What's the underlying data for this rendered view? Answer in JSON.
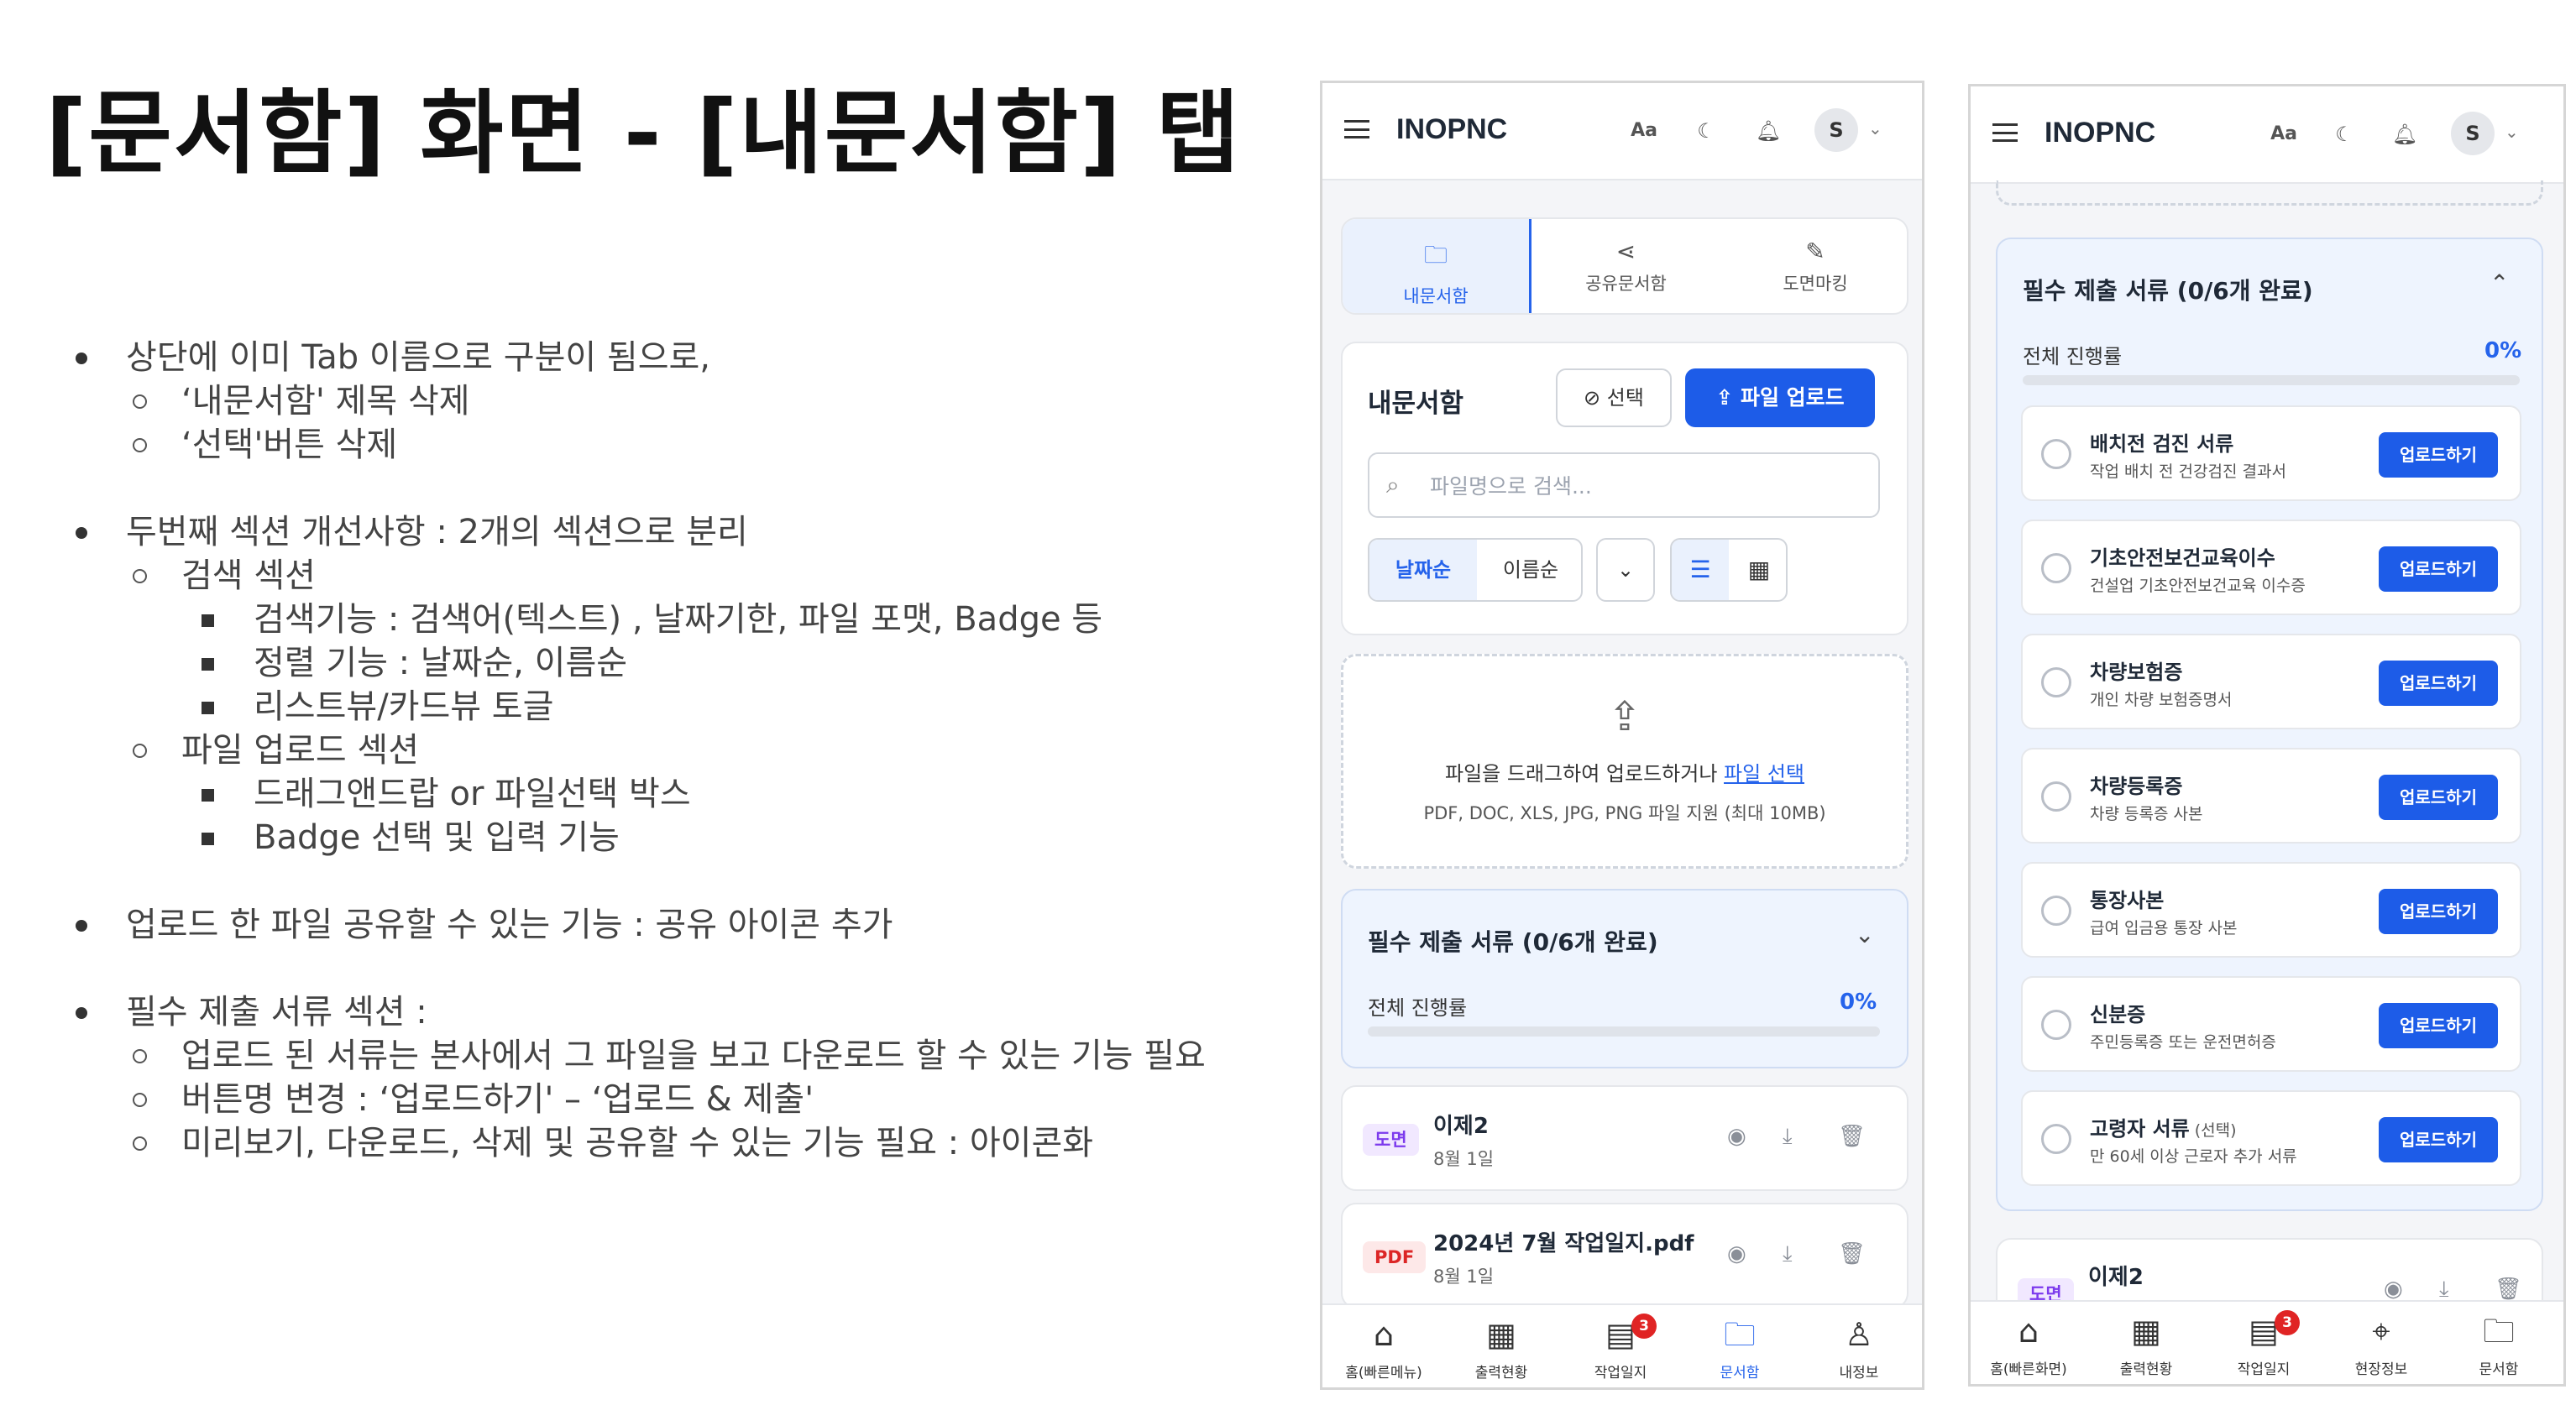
{
  "slide": {
    "title": "[문서함] 화면 - [내문서함] 탭",
    "notes": [
      {
        "level": 1,
        "text": "상단에 이미 Tab 이름으로 구분이 됨으로,"
      },
      {
        "level": 2,
        "text": "‘내문서함' 제목 삭제"
      },
      {
        "level": 2,
        "text": "‘선택'버튼 삭제"
      },
      {
        "level": 1,
        "text": "두번째 섹션 개선사항 : 2개의 섹션으로 분리",
        "gap": true
      },
      {
        "level": 2,
        "text": "검색 섹션"
      },
      {
        "level": 3,
        "text": "검색기능 : 검색어(텍스트) , 날짜기한, 파일 포맷, Badge 등"
      },
      {
        "level": 3,
        "text": "정렬 기능 : 날짜순, 이름순"
      },
      {
        "level": 3,
        "text": "리스트뷰/카드뷰 토글"
      },
      {
        "level": 2,
        "text": "파일 업로드 섹션"
      },
      {
        "level": 3,
        "text": "드래그앤드랍 or 파일선택 박스"
      },
      {
        "level": 3,
        "text": "Badge 선택 및 입력 기능"
      },
      {
        "level": 1,
        "text": "업로드 한 파일 공유할 수 있는 기능 : 공유 아이콘 추가",
        "gap": true
      },
      {
        "level": 1,
        "text": "필수 제출 서류 섹션 :",
        "gap": true
      },
      {
        "level": 2,
        "text": "업로드 된 서류는 본사에서 그 파일을 보고 다운로드 할 수 있는 기능 필요"
      },
      {
        "level": 2,
        "text": "버튼명 변경 : ‘업로드하기' – ‘업로드 & 제출'"
      },
      {
        "level": 2,
        "text": "미리보기, 다운로드, 삭제 및 공유할 수 있는 기능 필요 : 아이콘화"
      }
    ]
  },
  "app": {
    "logo": "INOPNC",
    "header_icons": {
      "font_size": "Aa",
      "avatar_letter": "S"
    },
    "tabs": [
      {
        "label": "내문서함",
        "icon": "folder-open-icon",
        "active": true
      },
      {
        "label": "공유문서함",
        "icon": "share-icon"
      },
      {
        "label": "도면마킹",
        "icon": "pencil-icon"
      }
    ],
    "doc_section": {
      "title": "내문서함",
      "select_label": "선택",
      "upload_label": "파일 업로드",
      "search_placeholder": "파일명으로 검색...",
      "sort": [
        "날짜순",
        "이름순"
      ]
    },
    "dropzone": {
      "text": "파일을 드래그하여 업로드하거나 ",
      "link": "파일 선택",
      "hint": "PDF, DOC, XLS, JPG, PNG 파일 지원 (최대 10MB)"
    },
    "required": {
      "title": "필수 제출 서류 (0/6개 완료)",
      "progress_label": "전체 진행률",
      "progress_value": "0%",
      "progress_fraction": 0
    },
    "files": [
      {
        "badge": "도면",
        "name": "이제2",
        "date": "8월 1일"
      },
      {
        "badge": "PDF",
        "name": "2024년 7월 작업일지.pdf",
        "date": "8월 1일"
      }
    ],
    "nav1": [
      {
        "label": "홈(빠른메뉴)",
        "icon": "home-icon"
      },
      {
        "label": "출력현황",
        "icon": "calendar-icon"
      },
      {
        "label": "작업일지",
        "icon": "document-icon",
        "badge": "3"
      },
      {
        "label": "문서함",
        "icon": "folder-icon",
        "active": true
      },
      {
        "label": "내정보",
        "icon": "user-icon"
      }
    ],
    "required_items": [
      {
        "title": "배치전 검진 서류",
        "desc": "작업 배치 전 건강검진 결과서",
        "button": "업로드하기"
      },
      {
        "title": "기초안전보건교육이수",
        "desc": "건설업 기초안전보건교육 이수증",
        "button": "업로드하기"
      },
      {
        "title": "차량보험증",
        "desc": "개인 차량 보험증명서",
        "button": "업로드하기"
      },
      {
        "title": "차량등록증",
        "desc": "차량 등록증 사본",
        "button": "업로드하기"
      },
      {
        "title": "통장사본",
        "desc": "급여 입금용 통장 사본",
        "button": "업로드하기"
      },
      {
        "title": "신분증",
        "desc": "주민등록증 또는 운전면허증",
        "button": "업로드하기"
      },
      {
        "title": "고령자 서류",
        "optional": "(선택)",
        "desc": "만 60세 이상 근로자 추가 서류",
        "button": "업로드하기"
      }
    ],
    "nav2": [
      {
        "label": "홈(빠른화면)",
        "icon": "home-icon"
      },
      {
        "label": "출력현황",
        "icon": "calendar-icon"
      },
      {
        "label": "작업일지",
        "icon": "document-icon",
        "badge": "3"
      },
      {
        "label": "현장정보",
        "icon": "map-pin-icon"
      },
      {
        "label": "문서함",
        "icon": "folder-icon"
      }
    ]
  },
  "colors": {
    "accent": "#1d5ce8",
    "active_tab_bg": "#eaf1fd",
    "badge_red": "#e02424"
  }
}
